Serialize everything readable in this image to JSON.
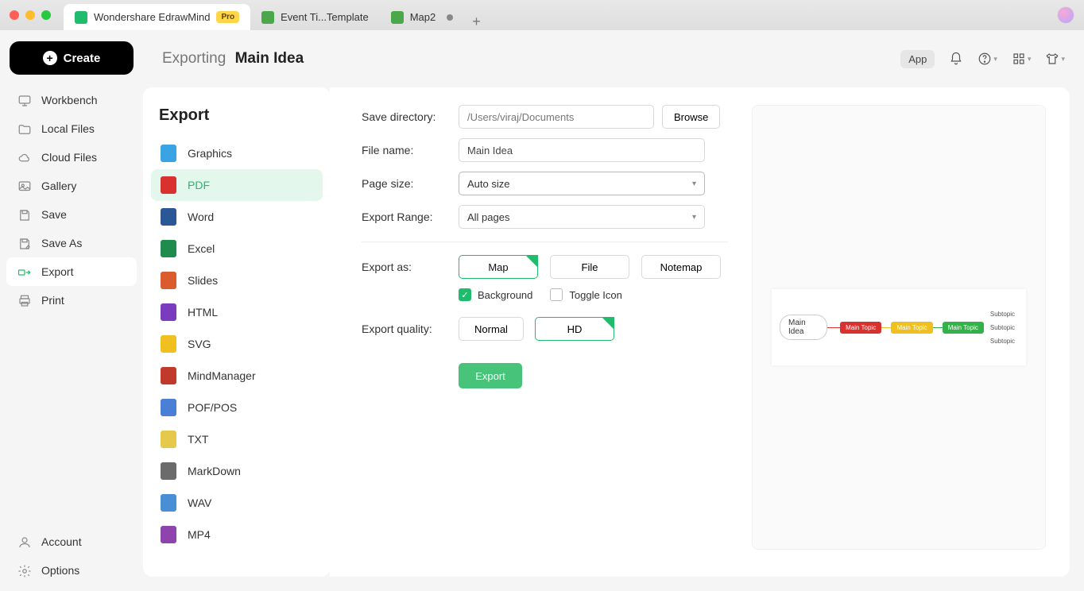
{
  "titlebar": {
    "tabs": [
      {
        "label": "Wondershare EdrawMind",
        "pro": "Pro"
      },
      {
        "label": "Event Ti...Template"
      },
      {
        "label": "Map2"
      }
    ]
  },
  "sidebar": {
    "create": "Create",
    "items": [
      "Workbench",
      "Local Files",
      "Cloud Files",
      "Gallery",
      "Save",
      "Save As",
      "Export",
      "Print"
    ],
    "bottom": [
      "Account",
      "Options"
    ]
  },
  "page": {
    "prefix": "Exporting",
    "title": "Main Idea"
  },
  "topbar": {
    "app": "App"
  },
  "export": {
    "title": "Export",
    "formats": [
      "Graphics",
      "PDF",
      "Word",
      "Excel",
      "Slides",
      "HTML",
      "SVG",
      "MindManager",
      "POF/POS",
      "TXT",
      "MarkDown",
      "WAV",
      "MP4"
    ]
  },
  "form": {
    "saveDirLabel": "Save directory:",
    "saveDir": "/Users/viraj/Documents",
    "browse": "Browse",
    "fileNameLabel": "File name:",
    "fileName": "Main Idea",
    "pageSizeLabel": "Page size:",
    "pageSize": "Auto size",
    "rangeLabel": "Export Range:",
    "range": "All pages",
    "exportAsLabel": "Export as:",
    "exportAs": {
      "map": "Map",
      "file": "File",
      "notemap": "Notemap"
    },
    "background": "Background",
    "toggleIcon": "Toggle Icon",
    "qualityLabel": "Export quality:",
    "quality": {
      "normal": "Normal",
      "hd": "HD"
    },
    "exportBtn": "Export"
  },
  "preview": {
    "root": "Main Idea",
    "t1": "Main Topic",
    "t2": "Main Topic",
    "t3": "Main Topic",
    "s1": "Subtopic",
    "s2": "Subtopic",
    "s3": "Subtopic",
    "c1": "#d9312e",
    "c2": "#f0c020",
    "c3": "#34b24a"
  },
  "fmtColors": {
    "Graphics": "#3aa3e3",
    "PDF": "#d9312e",
    "Word": "#2b5797",
    "Excel": "#1f8b4c",
    "Slides": "#d95b2e",
    "HTML": "#7a3bbf",
    "SVG": "#f0c020",
    "MindManager": "#c0392b",
    "POF/POS": "#4a7fd6",
    "TXT": "#e6c84a",
    "MarkDown": "#6b6b6b",
    "WAV": "#4a8fd6",
    "MP4": "#8e44ad"
  }
}
